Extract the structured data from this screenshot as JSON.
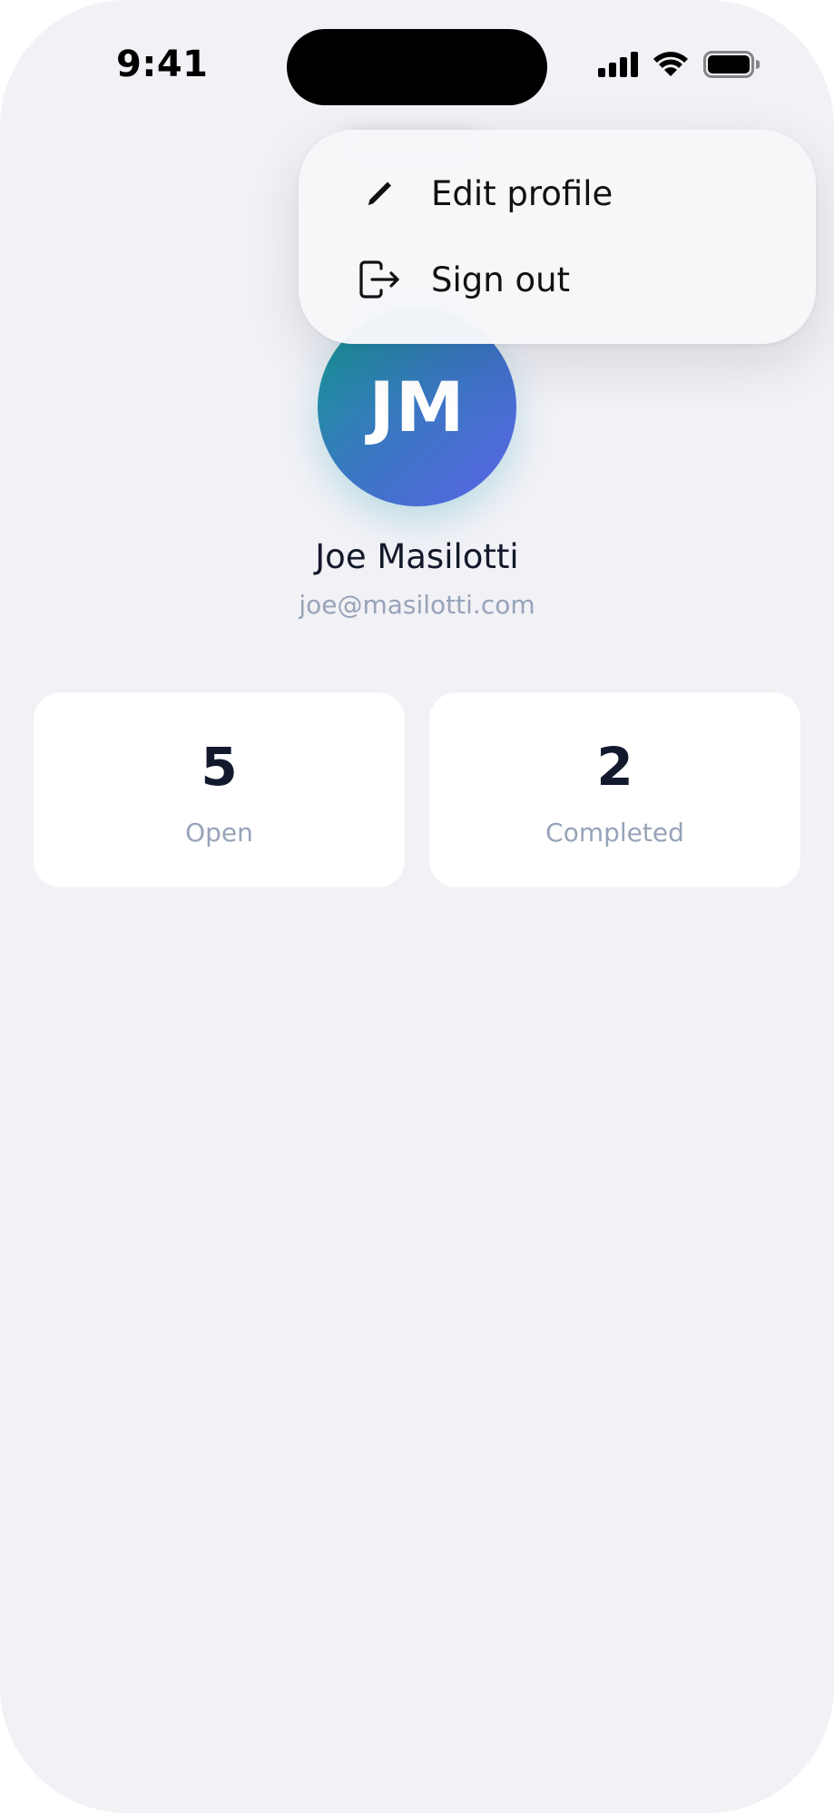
{
  "status_bar": {
    "time": "9:41",
    "signal_icon": "cellular-signal-icon",
    "wifi_icon": "wifi-icon",
    "battery_icon": "battery-icon"
  },
  "menu": {
    "items": [
      {
        "label": "Edit profile",
        "icon": "pencil-icon"
      },
      {
        "label": "Sign out",
        "icon": "sign-out-icon"
      }
    ]
  },
  "profile": {
    "initials": "JM",
    "name": "Joe Masilotti",
    "email": "joe@masilotti.com"
  },
  "stats": [
    {
      "value": "5",
      "label": "Open"
    },
    {
      "value": "2",
      "label": "Completed"
    }
  ],
  "colors": {
    "background": "#f1f1f6",
    "avatar_gradient_start": "#13998f",
    "avatar_gradient_end": "#5a63e6",
    "primary_text": "#14182b",
    "secondary_text": "#97a3b8"
  }
}
